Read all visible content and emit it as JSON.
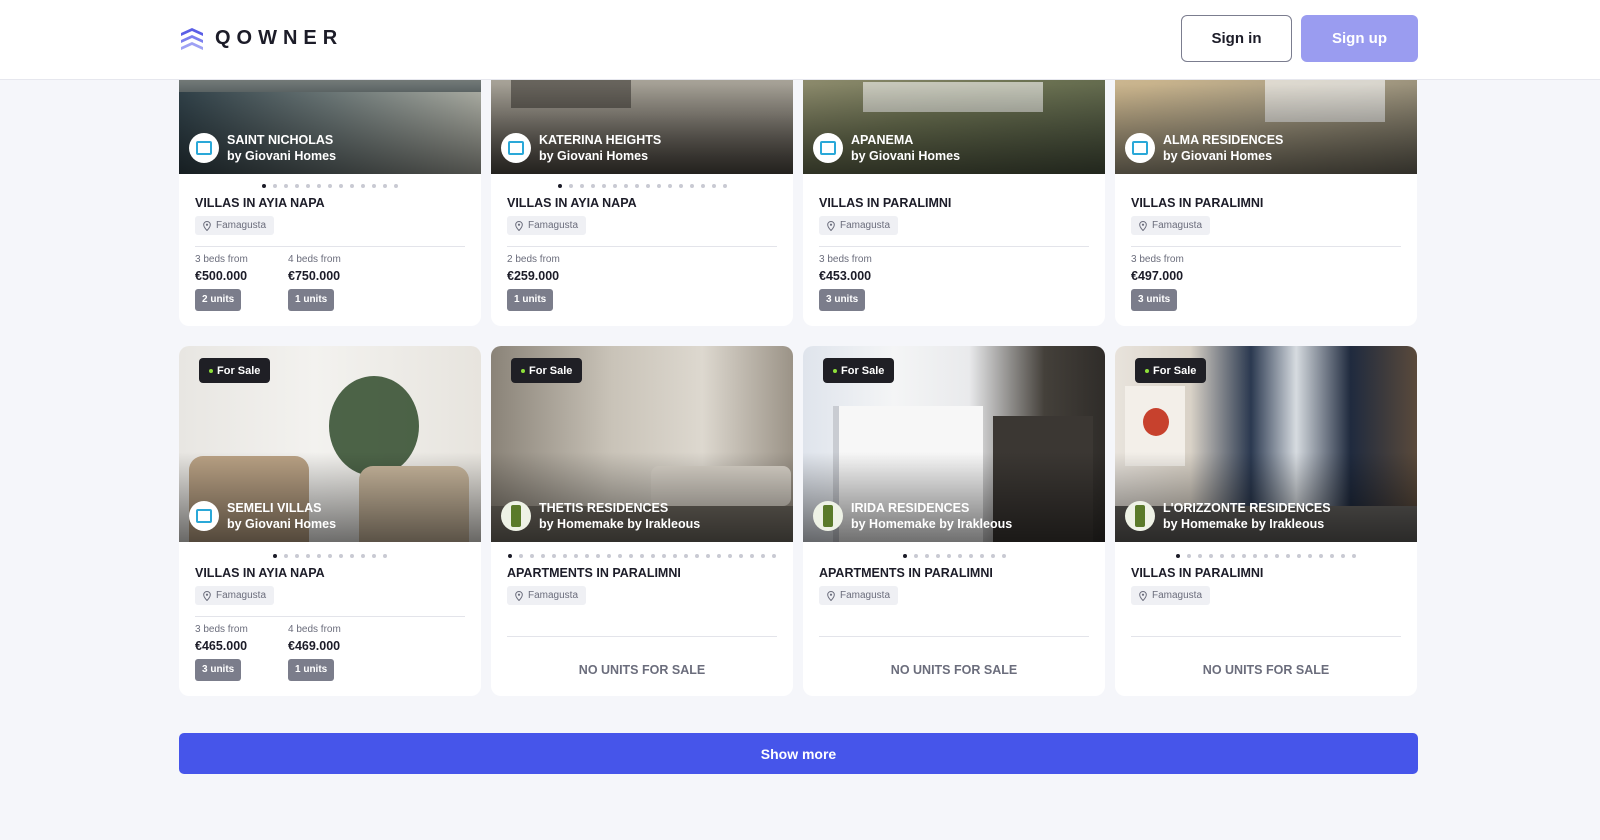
{
  "header": {
    "logo_text": "QOWNER",
    "signin_label": "Sign in",
    "signup_label": "Sign up"
  },
  "colors": {
    "accent": "#4655ea",
    "signup": "#9a9cf0",
    "badge_dot": "#8ee03a"
  },
  "row1": [
    {
      "name": "SAINT NICHOLAS",
      "developer": "by Giovani Homes",
      "type": "VILLAS IN AYIA NAPA",
      "location": "Famagusta",
      "prices": [
        {
          "label": "3 beds from",
          "price": "€500.000",
          "units": "2 units"
        },
        {
          "label": "4 beds from",
          "price": "€750.000",
          "units": "1 units"
        }
      ]
    },
    {
      "name": "KATERINA HEIGHTS",
      "developer": "by Giovani Homes",
      "type": "VILLAS IN AYIA NAPA",
      "location": "Famagusta",
      "prices": [
        {
          "label": "2 beds from",
          "price": "€259.000",
          "units": "1 units"
        }
      ]
    },
    {
      "name": "APANEMA",
      "developer": "by Giovani Homes",
      "type": "VILLAS IN PARALIMNI",
      "location": "Famagusta",
      "prices": [
        {
          "label": "3 beds from",
          "price": "€453.000",
          "units": "3 units"
        }
      ]
    },
    {
      "name": "ALMA RESIDENCES",
      "developer": "by Giovani Homes",
      "type": "VILLAS IN PARALIMNI",
      "location": "Famagusta",
      "prices": [
        {
          "label": "3 beds from",
          "price": "€497.000",
          "units": "3 units"
        }
      ]
    }
  ],
  "row2": [
    {
      "badge": "For Sale",
      "name": "SEMELI VILLAS",
      "developer": "by Giovani Homes",
      "type": "VILLAS IN AYIA NAPA",
      "location": "Famagusta",
      "prices": [
        {
          "label": "3 beds from",
          "price": "€465.000",
          "units": "3 units"
        },
        {
          "label": "4 beds from",
          "price": "€469.000",
          "units": "1 units"
        }
      ]
    },
    {
      "badge": "For Sale",
      "name": "THETIS RESIDENCES",
      "developer": "by Homemake by Irakleous",
      "type": "APARTMENTS IN PARALIMNI",
      "location": "Famagusta",
      "no_units": "NO UNITS FOR SALE"
    },
    {
      "badge": "For Sale",
      "name": "IRIDA RESIDENCES",
      "developer": "by Homemake by Irakleous",
      "type": "APARTMENTS IN PARALIMNI",
      "location": "Famagusta",
      "no_units": "NO UNITS FOR SALE"
    },
    {
      "badge": "For Sale",
      "name": "L'ORIZZONTE RESIDENCES",
      "developer": "by Homemake by Irakleous",
      "type": "VILLAS IN PARALIMNI",
      "location": "Famagusta",
      "no_units": "NO UNITS FOR SALE"
    }
  ],
  "show_more_label": "Show more"
}
